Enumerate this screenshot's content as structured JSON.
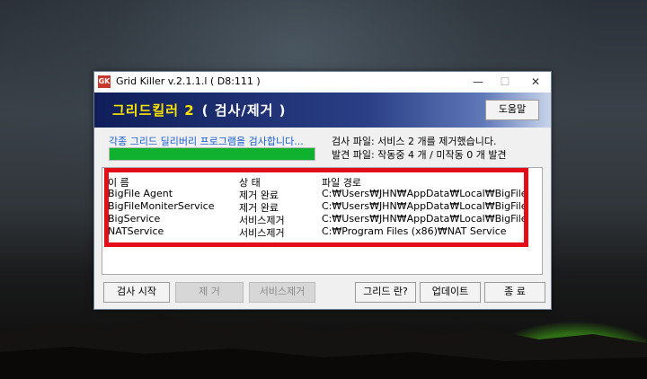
{
  "window": {
    "title": "Grid Killer v.2.1.1.l ( D8:111 )",
    "app_icon_text": "GK",
    "minimize_glyph": "—",
    "maximize_glyph": "☐",
    "close_glyph": "✕"
  },
  "banner": {
    "title": "그리드킬러 2",
    "subtitle": "( 검사/제거 )",
    "help_label": "도움말"
  },
  "status": {
    "message": "각종 그리드 딜리버리 프로그램을 검사합니다...",
    "progress": 1.0,
    "scan_file_info": "검사 파일:  서비스 2 개를 제거했습니다.",
    "found_info": "발견 파일:  작동중 4 개 / 미작동 0 개 발견"
  },
  "results": {
    "columns": [
      "이 름",
      "상 태",
      "파일 경로"
    ],
    "rows": [
      {
        "name": "BigFile Agent",
        "status": "제거 완료",
        "path": "C:₩Users₩JHN₩AppData₩Local₩BigFile"
      },
      {
        "name": "BigFileMoniterService",
        "status": "제거 완료",
        "path": "C:₩Users₩JHN₩AppData₩Local₩BigFile"
      },
      {
        "name": "BigService",
        "status": "서비스제거",
        "path": "C:₩Users₩JHN₩AppData₩Local₩BigFile"
      },
      {
        "name": "NATService",
        "status": "서비스제거",
        "path": "C:₩Program Files (x86)₩NAT Service"
      }
    ]
  },
  "buttons": {
    "start_scan": "검사 시작",
    "remove": "제 거",
    "remove_service": "서비스제거",
    "what_is_grid": "그리드 란?",
    "update": "업데이트",
    "exit": "종 료"
  },
  "colors": {
    "highlight_border": "#e20f1b",
    "progress_fill": "#0fb12e",
    "banner_title": "#ffe400",
    "status_text": "#1a5fd0"
  }
}
